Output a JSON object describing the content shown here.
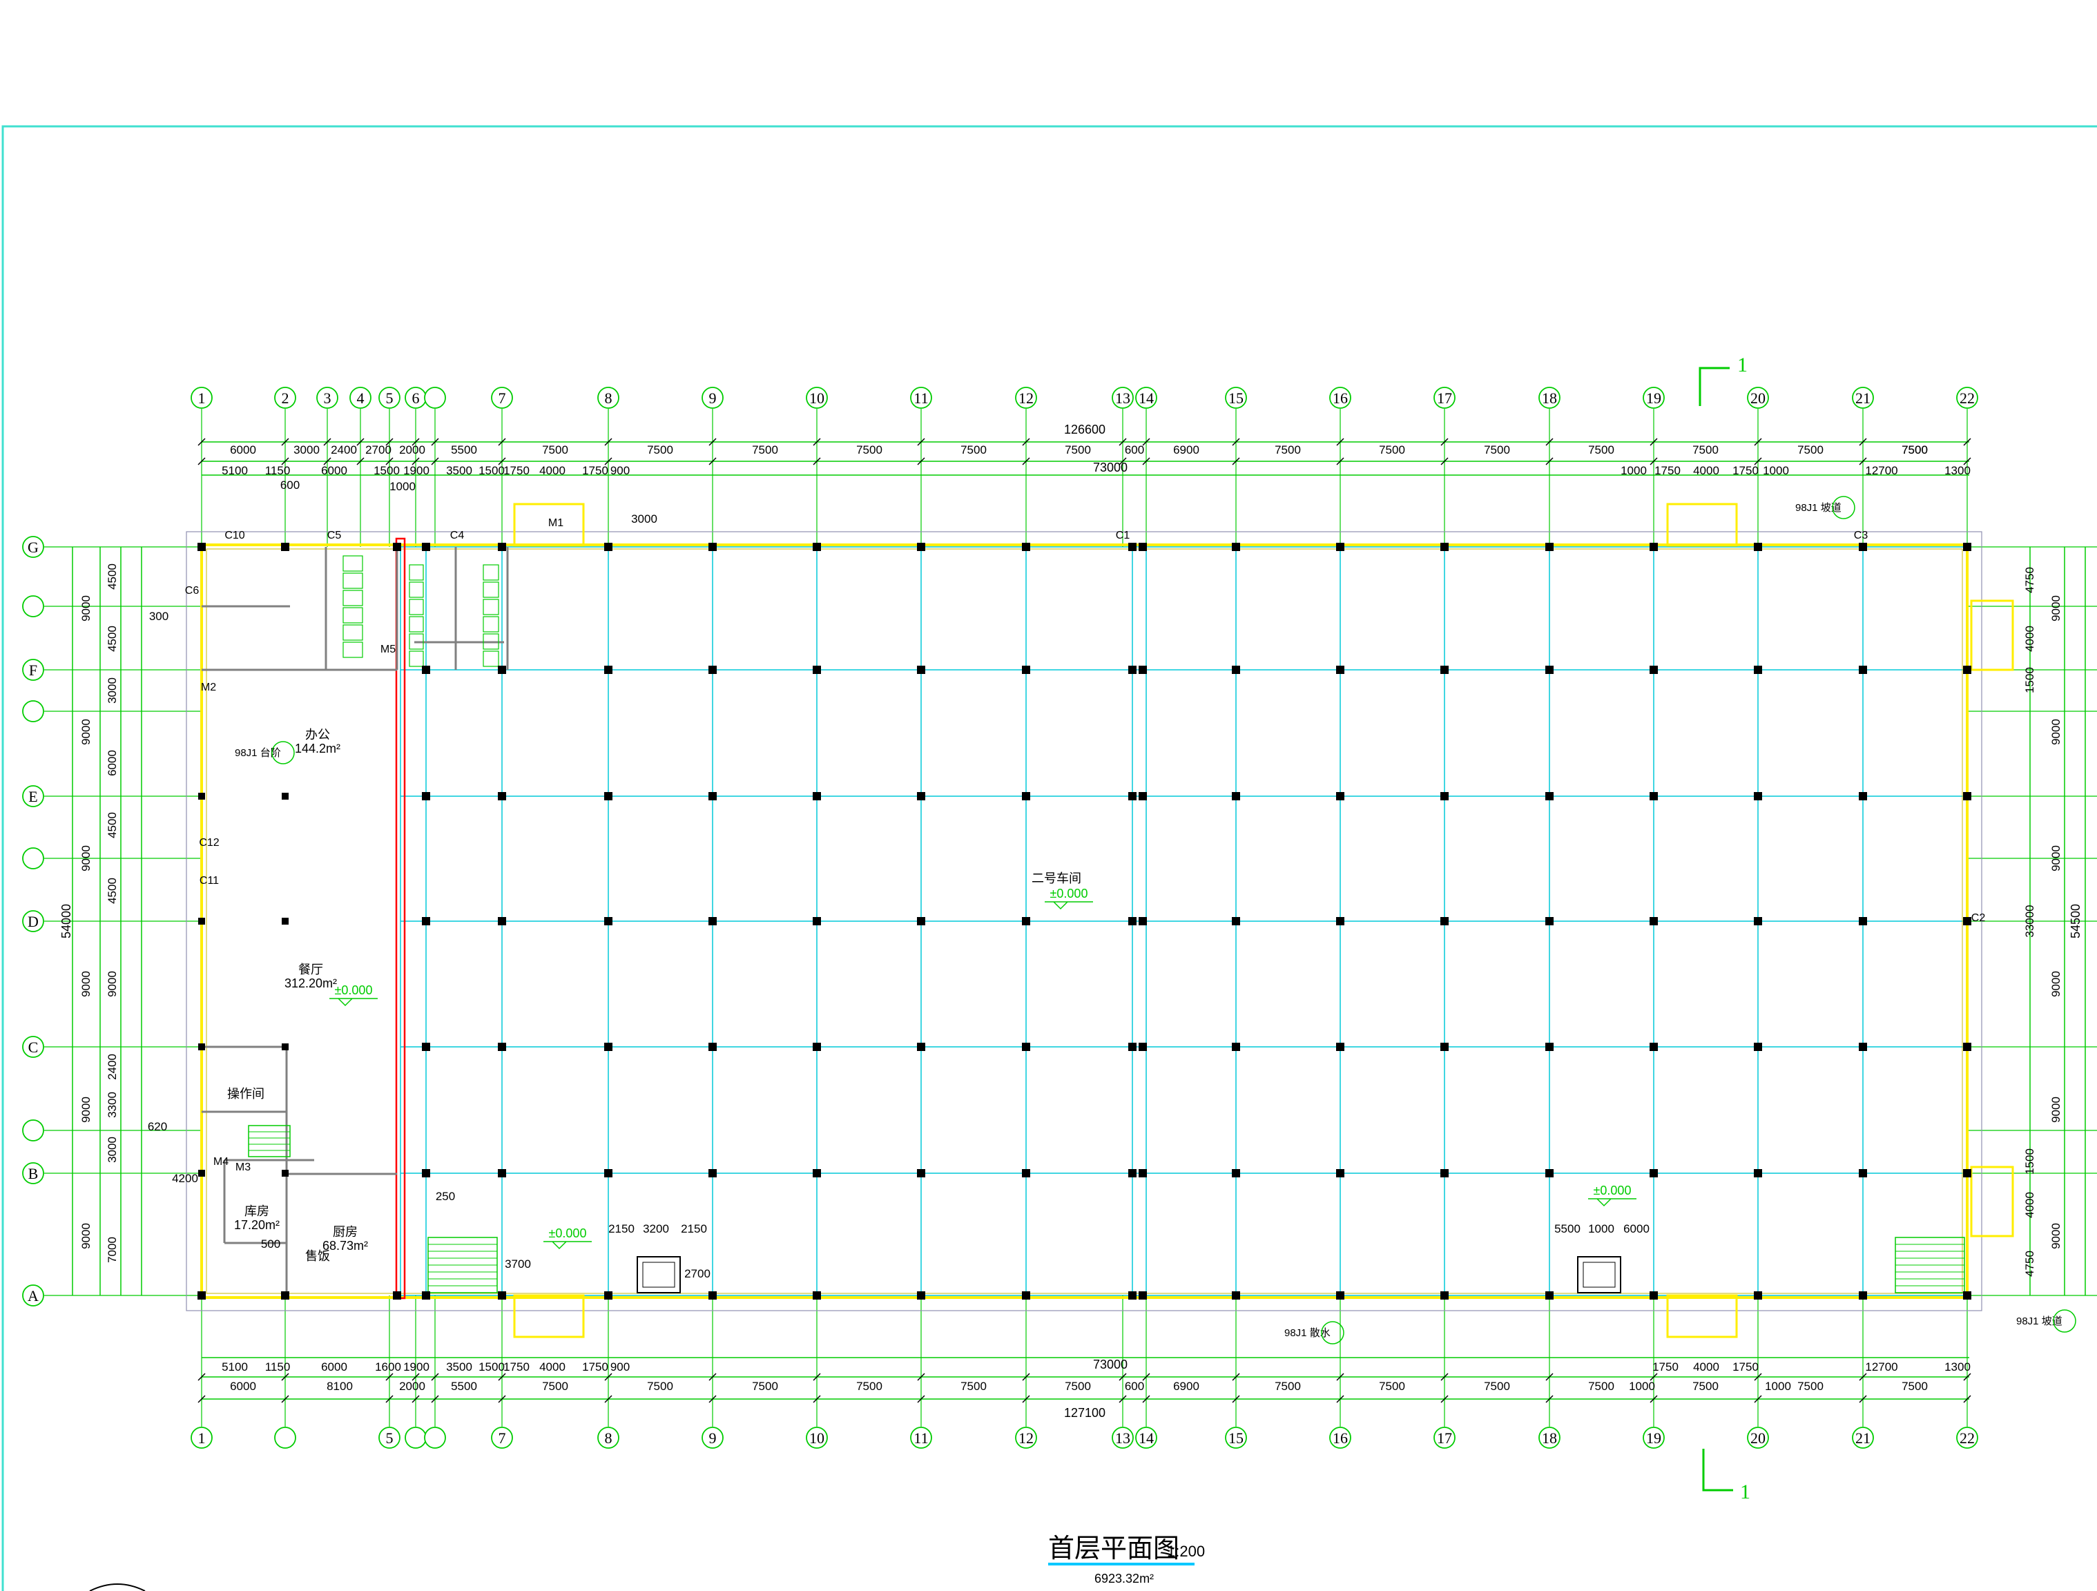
{
  "drawing": {
    "title": "首层平面图",
    "scale": "1:200",
    "area": "6923.32m²",
    "section_marker": "1"
  },
  "axes": {
    "top": [
      "1",
      "2",
      "3",
      "4",
      "5",
      "6",
      "",
      "7",
      "8",
      "9",
      "10",
      "11",
      "12",
      "13",
      "14",
      "15",
      "16",
      "17",
      "18",
      "19",
      "20",
      "21",
      "22"
    ],
    "bottom": [
      "1",
      "",
      "5",
      "",
      "",
      "7",
      "8",
      "9",
      "10",
      "11",
      "12",
      "13",
      "14",
      "15",
      "16",
      "17",
      "18",
      "19",
      "20",
      "21",
      "22"
    ],
    "rows": [
      "G",
      "",
      "F",
      "",
      "E",
      "",
      "D",
      "C",
      "",
      "B",
      "A"
    ]
  },
  "dimensions": {
    "overall_top": "126600",
    "overall_bottom": "127100",
    "overall_side": "54000",
    "overall_side_right": "54500",
    "inner_span": "73000",
    "top_row1": [
      "6000",
      "3000",
      "2400",
      "2700",
      "2000",
      "5500",
      "7500",
      "7500",
      "7500",
      "7500",
      "7500",
      "7500",
      "600",
      "6900",
      "7500",
      "7500",
      "7500",
      "7500",
      "7500",
      "7500",
      "7500",
      "7500"
    ],
    "top_row2": [
      "5100",
      "1150",
      "6000",
      "1500",
      "1900",
      "3500",
      "1500",
      "1750",
      "4000",
      "1750",
      "900",
      "1000",
      "1750",
      "4000",
      "1750",
      "1000",
      "12700",
      "1300"
    ],
    "bottom_row1": [
      "5100",
      "1150",
      "6000",
      "1600",
      "1900",
      "3500",
      "1500",
      "1750",
      "4000",
      "1750",
      "900",
      "1750",
      "4000",
      "1750",
      "12700",
      "1300"
    ],
    "bottom_row2": [
      "6000",
      "8100",
      "2000",
      "5500",
      "7500",
      "7500",
      "7500",
      "7500",
      "7500",
      "7500",
      "600",
      "6900",
      "7500",
      "7500",
      "7500",
      "7500",
      "1000",
      "7500",
      "1000",
      "7500",
      "7500"
    ],
    "left_col1": [
      "9000",
      "9000",
      "9000",
      "9000",
      "9000",
      "9000"
    ],
    "left_col2": [
      "4500",
      "4500",
      "3000",
      "6000",
      "4500",
      "4500",
      "9000",
      "2400",
      "3300",
      "3000",
      "7000"
    ],
    "right_col": [
      "9000",
      "9000",
      "9000",
      "9000",
      "9000",
      "9000"
    ],
    "right_inner": [
      "4750",
      "4000",
      "1500",
      "33000",
      "1500",
      "4000",
      "4750"
    ]
  },
  "rooms": [
    {
      "name": "办公",
      "area": "144.2m²"
    },
    {
      "name": "餐厅",
      "area": "312.20m²"
    },
    {
      "name": "库房",
      "area": "17.20m²"
    },
    {
      "name": "厨房",
      "area": "68.73m²"
    },
    {
      "name": "操作间",
      "area": ""
    },
    {
      "name": "售饭",
      "area": ""
    },
    {
      "name": "二号车间",
      "area": ""
    }
  ],
  "elevations": [
    "±0.000",
    "±0.000",
    "±0.000",
    "±0.000"
  ],
  "doors": [
    "M1",
    "M2",
    "M3",
    "M4",
    "M5"
  ],
  "windows": [
    "C1",
    "C2",
    "C3",
    "C4",
    "C5",
    "C6",
    "C10",
    "C11",
    "C12"
  ],
  "notes": [
    "98J1 坡道",
    "98J1 台阶",
    "98J1 散水",
    "98J1 坡道"
  ],
  "misc_labels": [
    "3000",
    "3700",
    "2700",
    "2150",
    "3200",
    "2150",
    "5500",
    "1000",
    "6000",
    "250",
    "300",
    "620",
    "4200",
    "500",
    "600",
    "1000"
  ],
  "colors": {
    "axis_grid": "#00c8d8",
    "dimension": "#00cc00",
    "wall": "#ffee00",
    "column": "#000000",
    "red_wall": "#ff0000",
    "frame": "#40e0d0",
    "text": "#000000"
  }
}
